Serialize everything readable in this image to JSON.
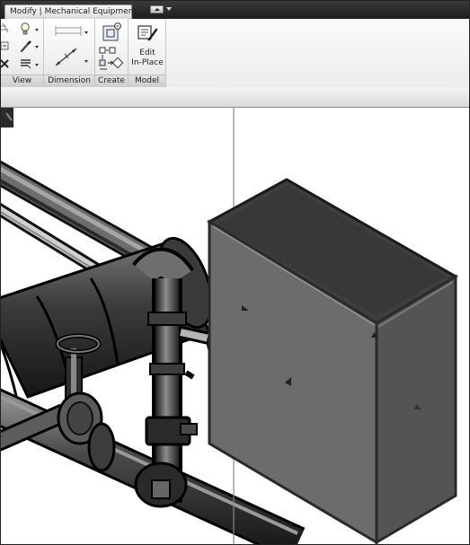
{
  "ribbon": {
    "context_tab": "Modify | Mechanical Equipment",
    "panels": {
      "view": "View",
      "dimension": "Dimension",
      "create": "Create",
      "model": "Model"
    },
    "edit_in_place": {
      "line1": "Edit",
      "line2": "In-Place"
    }
  },
  "colors": {
    "box_front": "#6c6c6c",
    "box_side": "#545454",
    "box_top": "#3e3e3e",
    "pipe": "#1e1e1e"
  }
}
